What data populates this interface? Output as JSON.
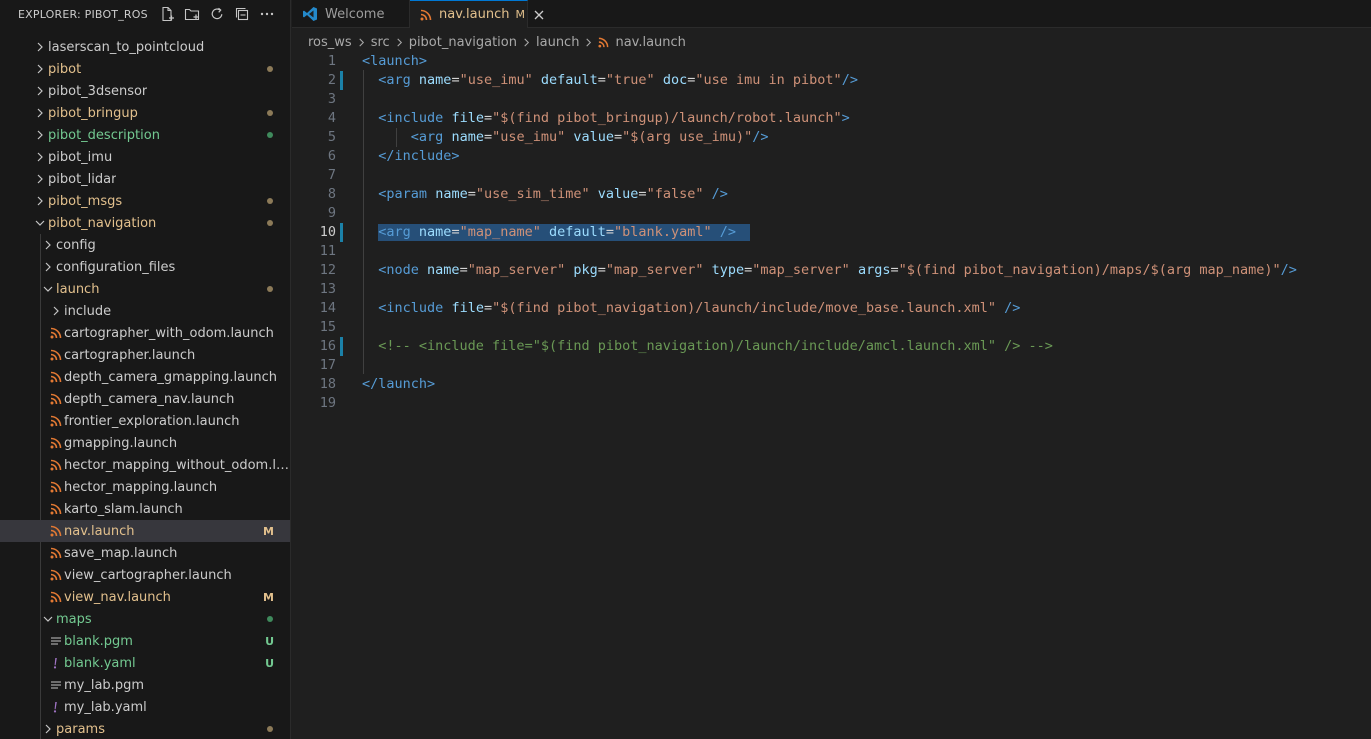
{
  "explorer": {
    "title": "EXPLORER: PIBOT_ROS",
    "actions": [
      {
        "icon": "new-file-icon"
      },
      {
        "icon": "new-folder-icon"
      },
      {
        "icon": "refresh-icon"
      },
      {
        "icon": "collapse-all-icon"
      },
      {
        "icon": "more-icon"
      }
    ],
    "tree": [
      {
        "name": "laserscan_to_pointcloud",
        "kind": "folder",
        "expanded": false,
        "depth": 1,
        "color": "#cccccc"
      },
      {
        "name": "pibot",
        "kind": "folder",
        "expanded": false,
        "depth": 1,
        "color": "#e2c08d",
        "dot": "#8c7a58"
      },
      {
        "name": "pibot_3dsensor",
        "kind": "folder",
        "expanded": false,
        "depth": 1,
        "color": "#cccccc"
      },
      {
        "name": "pibot_bringup",
        "kind": "folder",
        "expanded": false,
        "depth": 1,
        "color": "#e2c08d",
        "dot": "#8c7a58"
      },
      {
        "name": "pibot_description",
        "kind": "folder",
        "expanded": false,
        "depth": 1,
        "color": "#73c991",
        "dot": "#3f8a5c"
      },
      {
        "name": "pibot_imu",
        "kind": "folder",
        "expanded": false,
        "depth": 1,
        "color": "#cccccc"
      },
      {
        "name": "pibot_lidar",
        "kind": "folder",
        "expanded": false,
        "depth": 1,
        "color": "#cccccc"
      },
      {
        "name": "pibot_msgs",
        "kind": "folder",
        "expanded": false,
        "depth": 1,
        "color": "#e2c08d",
        "dot": "#8c7a58"
      },
      {
        "name": "pibot_navigation",
        "kind": "folder",
        "expanded": true,
        "depth": 1,
        "color": "#e2c08d",
        "dot": "#8c7a58"
      },
      {
        "name": "config",
        "kind": "folder",
        "expanded": false,
        "depth": 2,
        "color": "#cccccc"
      },
      {
        "name": "configuration_files",
        "kind": "folder",
        "expanded": false,
        "depth": 2,
        "color": "#cccccc"
      },
      {
        "name": "launch",
        "kind": "folder",
        "expanded": true,
        "depth": 2,
        "color": "#e2c08d",
        "dot": "#8c7a58"
      },
      {
        "name": "include",
        "kind": "folder",
        "expanded": false,
        "depth": 3,
        "color": "#cccccc"
      },
      {
        "name": "cartographer_with_odom.launch",
        "kind": "rss",
        "depth": 3,
        "color": "#cccccc"
      },
      {
        "name": "cartographer.launch",
        "kind": "rss",
        "depth": 3,
        "color": "#cccccc"
      },
      {
        "name": "depth_camera_gmapping.launch",
        "kind": "rss",
        "depth": 3,
        "color": "#cccccc"
      },
      {
        "name": "depth_camera_nav.launch",
        "kind": "rss",
        "depth": 3,
        "color": "#cccccc"
      },
      {
        "name": "frontier_exploration.launch",
        "kind": "rss",
        "depth": 3,
        "color": "#cccccc"
      },
      {
        "name": "gmapping.launch",
        "kind": "rss",
        "depth": 3,
        "color": "#cccccc"
      },
      {
        "name": "hector_mapping_without_odom.launch",
        "kind": "rss",
        "depth": 3,
        "color": "#cccccc"
      },
      {
        "name": "hector_mapping.launch",
        "kind": "rss",
        "depth": 3,
        "color": "#cccccc"
      },
      {
        "name": "karto_slam.launch",
        "kind": "rss",
        "depth": 3,
        "color": "#cccccc"
      },
      {
        "name": "nav.launch",
        "kind": "rss",
        "depth": 3,
        "color": "#e2c08d",
        "badge": "M",
        "badgeColor": "#e2c08d",
        "selected": true
      },
      {
        "name": "save_map.launch",
        "kind": "rss",
        "depth": 3,
        "color": "#cccccc"
      },
      {
        "name": "view_cartographer.launch",
        "kind": "rss",
        "depth": 3,
        "color": "#cccccc"
      },
      {
        "name": "view_nav.launch",
        "kind": "rss",
        "depth": 3,
        "color": "#e2c08d",
        "badge": "M",
        "badgeColor": "#e2c08d"
      },
      {
        "name": "maps",
        "kind": "folder",
        "expanded": true,
        "depth": 2,
        "color": "#73c991",
        "dot": "#3f8a5c"
      },
      {
        "name": "blank.pgm",
        "kind": "lines",
        "depth": 3,
        "color": "#73c991",
        "badge": "U",
        "badgeColor": "#73c991"
      },
      {
        "name": "blank.yaml",
        "kind": "yaml",
        "depth": 3,
        "color": "#73c991",
        "badge": "U",
        "badgeColor": "#73c991"
      },
      {
        "name": "my_lab.pgm",
        "kind": "lines",
        "depth": 3,
        "color": "#cccccc"
      },
      {
        "name": "my_lab.yaml",
        "kind": "yaml",
        "depth": 3,
        "color": "#cccccc"
      },
      {
        "name": "params",
        "kind": "folder",
        "expanded": false,
        "depth": 2,
        "color": "#e2c08d",
        "dot": "#8c7a58"
      }
    ]
  },
  "tabs": [
    {
      "label": "Welcome",
      "icon": "vscode-logo-icon",
      "active": false
    },
    {
      "label": "nav.launch",
      "icon": "rss-icon",
      "active": true,
      "modified": "M",
      "close": "close-icon"
    }
  ],
  "breadcrumb": [
    "ros_ws",
    "src",
    "pibot_navigation",
    "launch",
    "nav.launch"
  ],
  "colors": {
    "accent": "#0078d4",
    "modified": "#e2c08d",
    "untracked": "#73c991",
    "rss_icon": "#e37933",
    "yaml_icon": "#a074c4"
  },
  "editor": {
    "current_line": 10,
    "lines": [
      {
        "n": "1",
        "tokens": [
          [
            "tag",
            "<launch>"
          ]
        ]
      },
      {
        "n": "2",
        "mark": true,
        "tokens": [
          [
            "def",
            "  "
          ],
          [
            "tag",
            "<arg"
          ],
          [
            "def",
            " "
          ],
          [
            "attr",
            "name"
          ],
          [
            "def",
            "="
          ],
          [
            "str",
            "\"use_imu\""
          ],
          [
            "def",
            " "
          ],
          [
            "attr",
            "default"
          ],
          [
            "def",
            "="
          ],
          [
            "str",
            "\"true\""
          ],
          [
            "def",
            " "
          ],
          [
            "attr",
            "doc"
          ],
          [
            "def",
            "="
          ],
          [
            "str",
            "\"use imu in pibot\""
          ],
          [
            "tag",
            "/>"
          ]
        ]
      },
      {
        "n": "3",
        "tokens": []
      },
      {
        "n": "4",
        "tokens": [
          [
            "def",
            "  "
          ],
          [
            "tag",
            "<include"
          ],
          [
            "def",
            " "
          ],
          [
            "attr",
            "file"
          ],
          [
            "def",
            "="
          ],
          [
            "str",
            "\"$(find pibot_bringup)/launch/robot.launch\""
          ],
          [
            "tag",
            ">"
          ]
        ]
      },
      {
        "n": "5",
        "tokens": [
          [
            "def",
            "      "
          ],
          [
            "tag",
            "<arg"
          ],
          [
            "def",
            " "
          ],
          [
            "attr",
            "name"
          ],
          [
            "def",
            "="
          ],
          [
            "str",
            "\"use_imu\""
          ],
          [
            "def",
            " "
          ],
          [
            "attr",
            "value"
          ],
          [
            "def",
            "="
          ],
          [
            "str",
            "\"$(arg use_imu)\""
          ],
          [
            "tag",
            "/>"
          ]
        ]
      },
      {
        "n": "6",
        "tokens": [
          [
            "def",
            "  "
          ],
          [
            "tag",
            "</include>"
          ]
        ]
      },
      {
        "n": "7",
        "tokens": []
      },
      {
        "n": "8",
        "tokens": [
          [
            "def",
            "  "
          ],
          [
            "tag",
            "<param"
          ],
          [
            "def",
            " "
          ],
          [
            "attr",
            "name"
          ],
          [
            "def",
            "="
          ],
          [
            "str",
            "\"use_sim_time\""
          ],
          [
            "def",
            " "
          ],
          [
            "attr",
            "value"
          ],
          [
            "def",
            "="
          ],
          [
            "str",
            "\"false\""
          ],
          [
            "def",
            " "
          ],
          [
            "tag",
            "/>"
          ]
        ]
      },
      {
        "n": "9",
        "tokens": []
      },
      {
        "n": "10",
        "mark": true,
        "selected": true,
        "tokens": [
          [
            "def",
            "  "
          ],
          [
            "tag",
            "<arg"
          ],
          [
            "def",
            " "
          ],
          [
            "attr",
            "name"
          ],
          [
            "def",
            "="
          ],
          [
            "str",
            "\"map_name\""
          ],
          [
            "def",
            " "
          ],
          [
            "attr",
            "default"
          ],
          [
            "def",
            "="
          ],
          [
            "str",
            "\"blank.yaml\""
          ],
          [
            "def",
            " "
          ],
          [
            "tag",
            "/>"
          ]
        ]
      },
      {
        "n": "11",
        "tokens": []
      },
      {
        "n": "12",
        "tokens": [
          [
            "def",
            "  "
          ],
          [
            "tag",
            "<node"
          ],
          [
            "def",
            " "
          ],
          [
            "attr",
            "name"
          ],
          [
            "def",
            "="
          ],
          [
            "str",
            "\"map_server\""
          ],
          [
            "def",
            " "
          ],
          [
            "attr",
            "pkg"
          ],
          [
            "def",
            "="
          ],
          [
            "str",
            "\"map_server\""
          ],
          [
            "def",
            " "
          ],
          [
            "attr",
            "type"
          ],
          [
            "def",
            "="
          ],
          [
            "str",
            "\"map_server\""
          ],
          [
            "def",
            " "
          ],
          [
            "attr",
            "args"
          ],
          [
            "def",
            "="
          ],
          [
            "str",
            "\"$(find pibot_navigation)/maps/$(arg map_name)\""
          ],
          [
            "tag",
            "/>"
          ]
        ]
      },
      {
        "n": "13",
        "tokens": []
      },
      {
        "n": "14",
        "tokens": [
          [
            "def",
            "  "
          ],
          [
            "tag",
            "<include"
          ],
          [
            "def",
            " "
          ],
          [
            "attr",
            "file"
          ],
          [
            "def",
            "="
          ],
          [
            "str",
            "\"$(find pibot_navigation)/launch/include/move_base.launch.xml\""
          ],
          [
            "def",
            " "
          ],
          [
            "tag",
            "/>"
          ]
        ]
      },
      {
        "n": "15",
        "tokens": []
      },
      {
        "n": "16",
        "mark": true,
        "tokens": [
          [
            "def",
            "  "
          ],
          [
            "cmt",
            "<!-- <include file=\"$(find pibot_navigation)/launch/include/amcl.launch.xml\" /> -->"
          ]
        ]
      },
      {
        "n": "17",
        "tokens": []
      },
      {
        "n": "18",
        "tokens": [
          [
            "tag",
            "</launch>"
          ]
        ]
      },
      {
        "n": "19",
        "tokens": []
      }
    ]
  }
}
